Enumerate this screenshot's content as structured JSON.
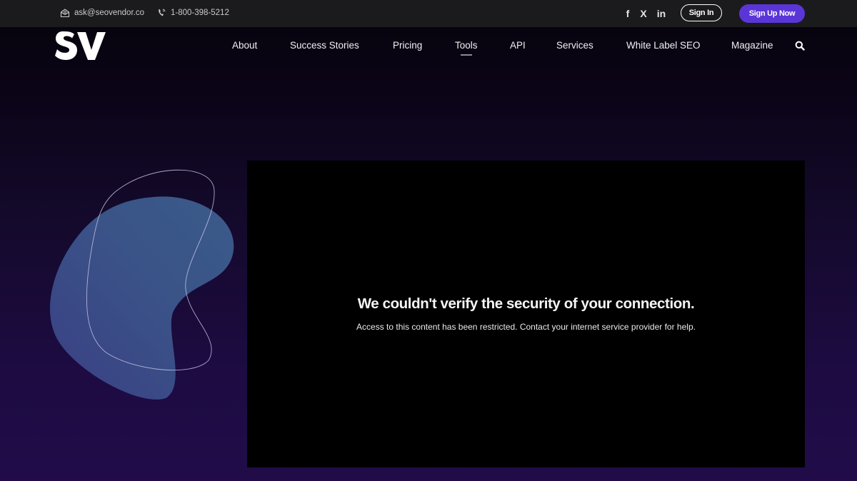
{
  "topbar": {
    "email": "ask@seovendor.co",
    "phone": "1-800-398-5212",
    "social": [
      {
        "icon": "facebook-icon",
        "label": "f"
      },
      {
        "icon": "x-icon",
        "label": "X"
      },
      {
        "icon": "linkedin-icon",
        "label": "in"
      }
    ],
    "signin_label": "Sign In",
    "signup_label": "Sign Up Now"
  },
  "brand": {
    "logo_text": "SV"
  },
  "nav": {
    "items": [
      "About",
      "Success Stories",
      "Pricing",
      "Tools",
      "API",
      "Services",
      "White Label SEO",
      "Magazine"
    ],
    "active": "Tools"
  },
  "main": {
    "title": "We couldn't verify the security of your connection.",
    "message": "Access to this content has been restricted. Contact your internet service provider for help."
  },
  "colors": {
    "accent": "#5a35d8",
    "topbar_bg": "#1b1b1d",
    "page_bg": "#1d0b42",
    "blob": "#3a5488"
  }
}
